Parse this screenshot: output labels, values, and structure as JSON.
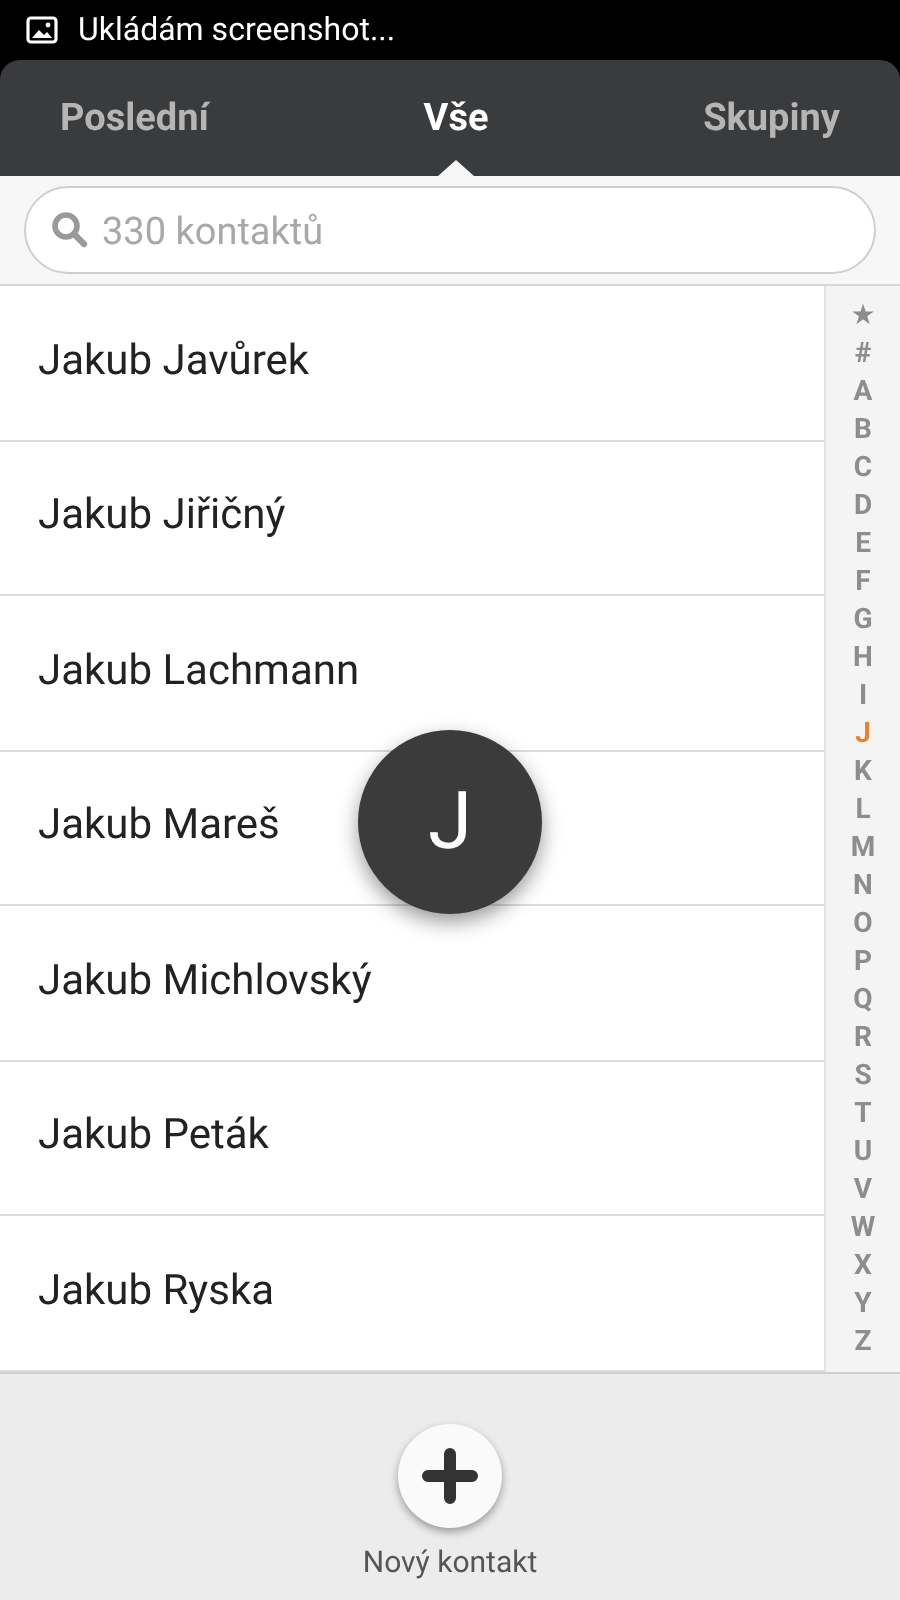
{
  "status_bar": {
    "notification": "Ukládám screenshot..."
  },
  "tabs": [
    {
      "label": "Poslední",
      "selected": false
    },
    {
      "label": "Vše",
      "selected": true
    },
    {
      "label": "Skupiny",
      "selected": false
    }
  ],
  "search": {
    "placeholder": "330 kontaktů"
  },
  "contacts": [
    "Jakub Javůrek",
    "Jakub Jiřičný",
    "Jakub Lachmann",
    "Jakub Mareš",
    "Jakub Michlovský",
    "Jakub Peták",
    "Jakub Ryska"
  ],
  "letter_popup": "J",
  "index": [
    {
      "label": "★",
      "selected": false
    },
    {
      "label": "#",
      "selected": false
    },
    {
      "label": "A",
      "selected": false
    },
    {
      "label": "B",
      "selected": false
    },
    {
      "label": "C",
      "selected": false
    },
    {
      "label": "D",
      "selected": false
    },
    {
      "label": "E",
      "selected": false
    },
    {
      "label": "F",
      "selected": false
    },
    {
      "label": "G",
      "selected": false
    },
    {
      "label": "H",
      "selected": false
    },
    {
      "label": "I",
      "selected": false
    },
    {
      "label": "J",
      "selected": true
    },
    {
      "label": "K",
      "selected": false
    },
    {
      "label": "L",
      "selected": false
    },
    {
      "label": "M",
      "selected": false
    },
    {
      "label": "N",
      "selected": false
    },
    {
      "label": "O",
      "selected": false
    },
    {
      "label": "P",
      "selected": false
    },
    {
      "label": "Q",
      "selected": false
    },
    {
      "label": "R",
      "selected": false
    },
    {
      "label": "S",
      "selected": false
    },
    {
      "label": "T",
      "selected": false
    },
    {
      "label": "U",
      "selected": false
    },
    {
      "label": "V",
      "selected": false
    },
    {
      "label": "W",
      "selected": false
    },
    {
      "label": "X",
      "selected": false
    },
    {
      "label": "Y",
      "selected": false
    },
    {
      "label": "Z",
      "selected": false
    }
  ],
  "new_contact": {
    "label": "Nový kontakt"
  }
}
